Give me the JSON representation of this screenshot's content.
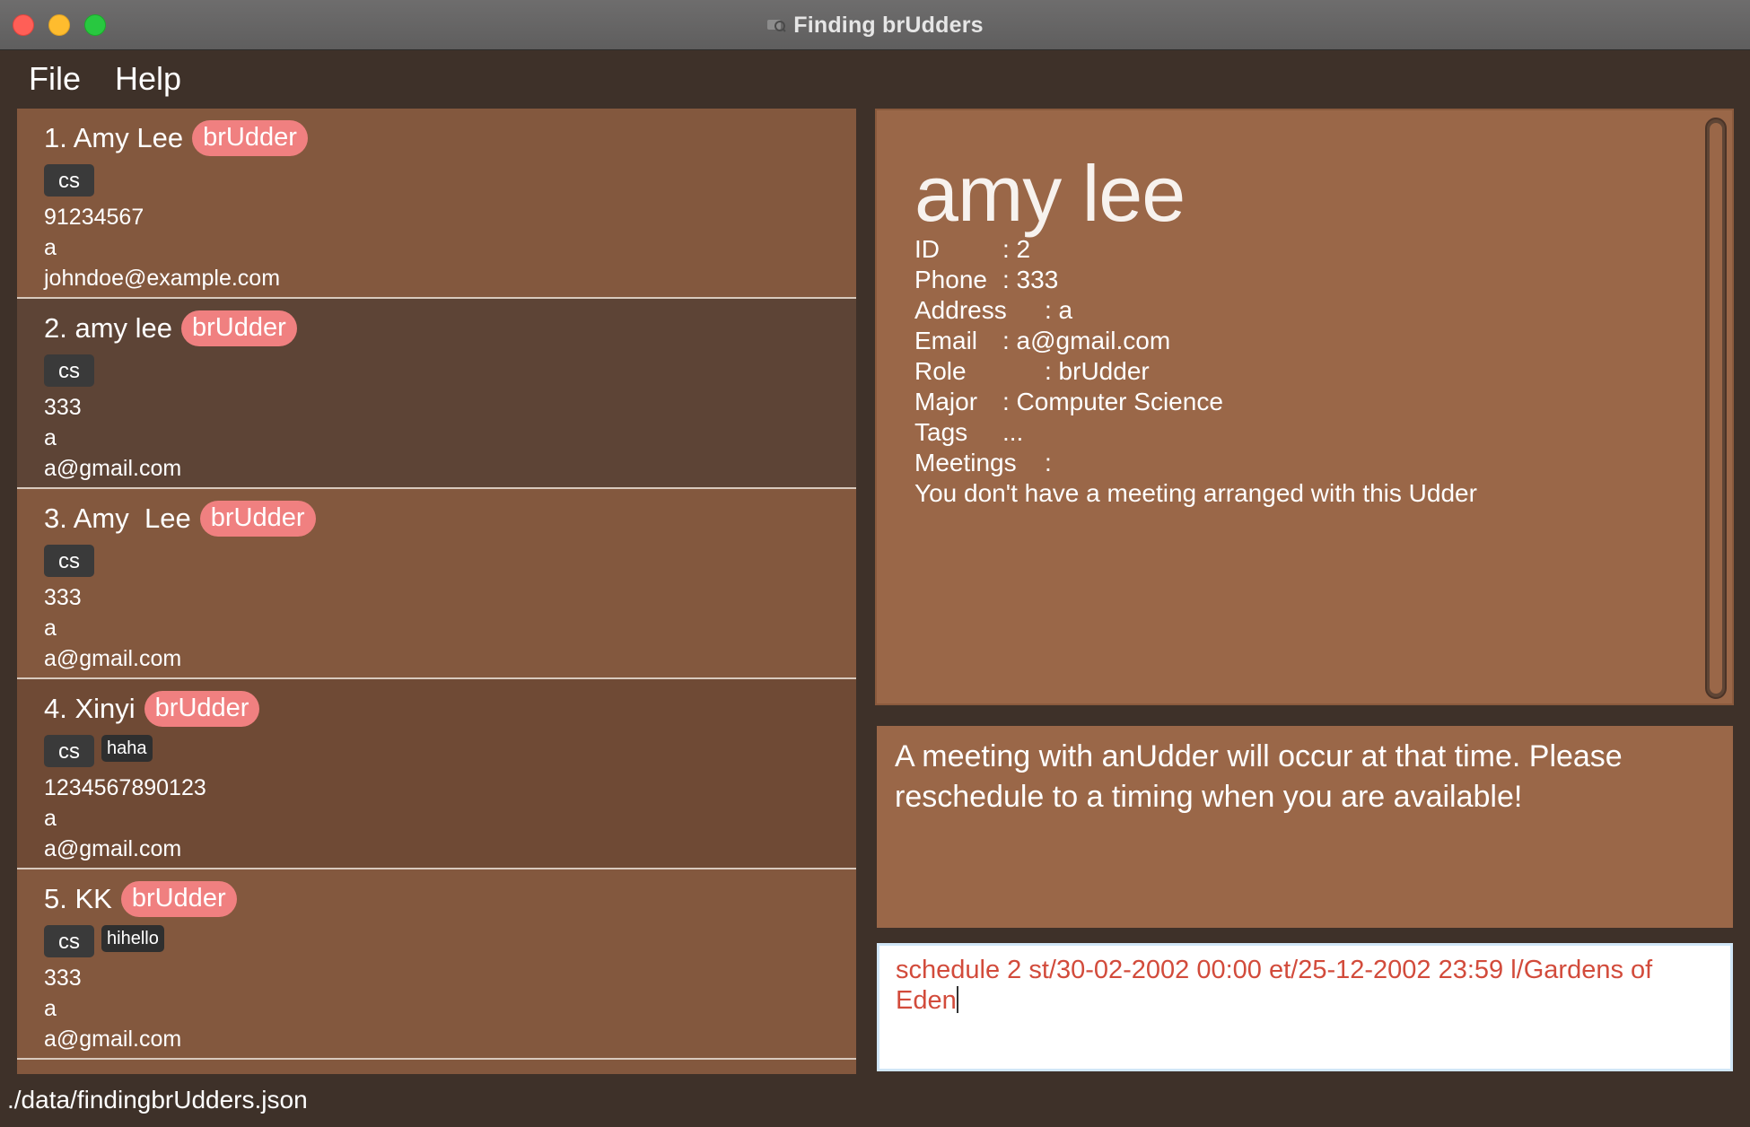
{
  "window": {
    "title": "Finding brUdders"
  },
  "menu": {
    "file": "File",
    "help": "Help"
  },
  "persons": [
    {
      "name": "1. Amy Lee",
      "role": "brUdder",
      "tags": [
        "cs"
      ],
      "phone": "91234567",
      "address": "a",
      "email": "johndoe@example.com"
    },
    {
      "name": "2. amy lee",
      "role": "brUdder",
      "tags": [
        "cs"
      ],
      "phone": "333",
      "address": "a",
      "email": "a@gmail.com"
    },
    {
      "name": "3. Amy  Lee",
      "role": "brUdder",
      "tags": [
        "cs"
      ],
      "phone": "333",
      "address": "a",
      "email": "a@gmail.com"
    },
    {
      "name": "4. Xinyi",
      "role": "brUdder",
      "tags": [
        "cs",
        "haha"
      ],
      "phone": "1234567890123",
      "address": "a",
      "email": "a@gmail.com"
    },
    {
      "name": "5. KK",
      "role": "brUdder",
      "tags": [
        "cs",
        "hihello"
      ],
      "phone": "333",
      "address": "a",
      "email": "a@gmail.com"
    }
  ],
  "detail": {
    "name": "amy lee",
    "id_label": "ID",
    "id_value": ": 2",
    "phone_label": "Phone",
    "phone_value": ": 333",
    "address_label": "Address",
    "address_value": ": a",
    "email_label": "Email",
    "email_value": ": a@gmail.com",
    "role_label": "Role",
    "role_value": ": brUdder",
    "major_label": "Major",
    "major_value": ": Computer Science",
    "tags_label": "Tags",
    "tags_value": "...",
    "meetings_label": "Meetings",
    "meetings_value": ":",
    "meetings_note": "You don't have a meeting arranged with this Udder"
  },
  "result": {
    "message": "A meeting with anUdder will occur at that time. Please reschedule to a timing when you are available!"
  },
  "command": {
    "value": "schedule 2 st/30-02-2002 00:00 et/25-12-2002 23:59 l/Gardens of Eden"
  },
  "status": {
    "path": "./data/findingbrUdders.json"
  },
  "colors": {
    "background": "#3e3129",
    "card_primary": "#83583e",
    "card_alt": "#5d4436",
    "detail_panel": "#9a6748",
    "role_badge": "#f08080",
    "command_text": "#d24b3b"
  }
}
